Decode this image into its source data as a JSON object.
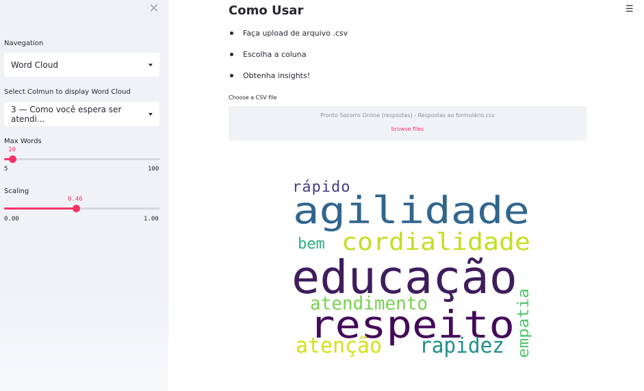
{
  "sidebar": {
    "close_icon": "close-icon",
    "navigation": {
      "label": "Navegation",
      "value": "Word Cloud"
    },
    "column_select": {
      "label": "Select Colmun to display Word Cloud",
      "value": "3 — Como você espera ser atendi..."
    },
    "max_words": {
      "label": "Max Words",
      "value": "10",
      "min": "5",
      "max": "100",
      "fraction": 0.053
    },
    "scaling": {
      "label": "Scaling",
      "value": "0.46",
      "min": "0.00",
      "max": "1.00",
      "fraction": 0.46
    }
  },
  "main": {
    "title": "Como Usar",
    "menu_icon": "hamburger-menu-icon",
    "steps": [
      "Faça upload de arquivo .csv",
      "Escolha a coluna",
      "Obtenha insights!"
    ],
    "uploader": {
      "label": "Choose a CSV file",
      "file_name": "Pronto Socorro Online (respostas) - Respostas ao formulário.csv",
      "browse": "browse files"
    },
    "wordcloud": {
      "words": [
        {
          "text": "rápido",
          "color": "#433e85"
        },
        {
          "text": "agilidade",
          "color": "#31668e"
        },
        {
          "text": "bem",
          "color": "#29af7f"
        },
        {
          "text": "cordialidade",
          "color": "#c2df23"
        },
        {
          "text": "educação",
          "color": "#3f1d5c"
        },
        {
          "text": "atendimento",
          "color": "#7ad151"
        },
        {
          "text": "respeito",
          "color": "#440a59"
        },
        {
          "text": "empatia",
          "color": "#4fc46a"
        },
        {
          "text": "atenção",
          "color": "#d5e21a"
        },
        {
          "text": "rapidez",
          "color": "#218f8d"
        }
      ]
    }
  }
}
